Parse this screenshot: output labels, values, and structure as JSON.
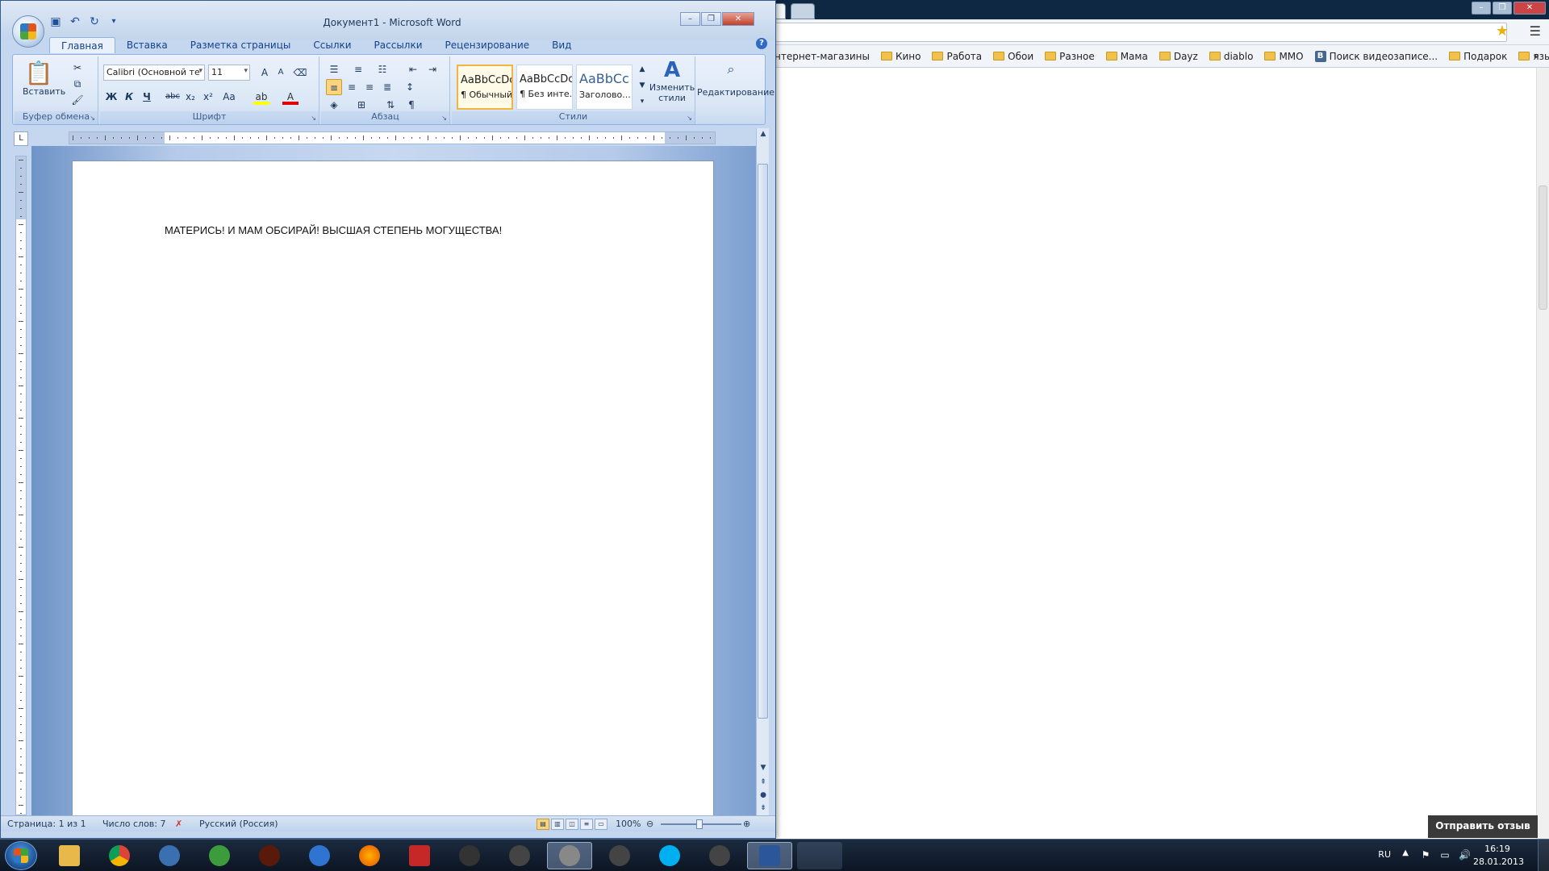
{
  "browser": {
    "bookmarks": [
      {
        "label": "нтернет-магазины",
        "icon": "none"
      },
      {
        "label": "Кино",
        "icon": "folder"
      },
      {
        "label": "Работа",
        "icon": "folder"
      },
      {
        "label": "Обои",
        "icon": "folder"
      },
      {
        "label": "Разное",
        "icon": "folder"
      },
      {
        "label": "Мама",
        "icon": "folder"
      },
      {
        "label": "Dayz",
        "icon": "folder"
      },
      {
        "label": "diablo",
        "icon": "folder"
      },
      {
        "label": "MMO",
        "icon": "folder"
      },
      {
        "label": "Поиск видеозаписе...",
        "icon": "vk"
      },
      {
        "label": "Подарок",
        "icon": "folder"
      },
      {
        "label": "языки",
        "icon": "folder"
      }
    ],
    "vk_glyph": "B",
    "more_label": "»",
    "feedback_label": "Отправить отзыв"
  },
  "word": {
    "title": "Документ1 - Microsoft Word",
    "tabs": [
      "Главная",
      "Вставка",
      "Разметка страницы",
      "Ссылки",
      "Рассылки",
      "Рецензирование",
      "Вид"
    ],
    "groups": {
      "clipboard": "Буфер обмена",
      "font": "Шрифт",
      "paragraph": "Абзац",
      "styles": "Стили"
    },
    "paste_label": "Вставить",
    "font_name": "Calibri (Основной те",
    "font_size": "11",
    "format_buttons": [
      "Ж",
      "К",
      "Ч",
      "abc",
      "x₂",
      "x²",
      "Aa"
    ],
    "styles": [
      {
        "sample": "AaBbCcDc",
        "name": "¶ Обычный"
      },
      {
        "sample": "AaBbCcDc",
        "name": "¶ Без инте..."
      },
      {
        "sample": "AaBbCc",
        "name": "Заголово..."
      }
    ],
    "change_styles_label_1": "Изменить",
    "change_styles_label_2": "стили",
    "editing_label": "Редактирование",
    "ruler_corner": "L",
    "document_text": "МАТЕРИСЬ! И МАМ ОБСИРАЙ! ВЫСШАЯ СТЕПЕНЬ МОГУЩЕСТВА!",
    "status": {
      "page": "Страница: 1 из 1",
      "words": "Число слов: 7",
      "language": "Русский (Россия)",
      "zoom": "100%"
    }
  },
  "tray": {
    "lang": "RU",
    "time": "16:19",
    "date": "28.01.2013"
  },
  "colors": {
    "word_frame": "#c4d7ef",
    "taskbar": "#0c1523",
    "accent": "#15428b"
  }
}
